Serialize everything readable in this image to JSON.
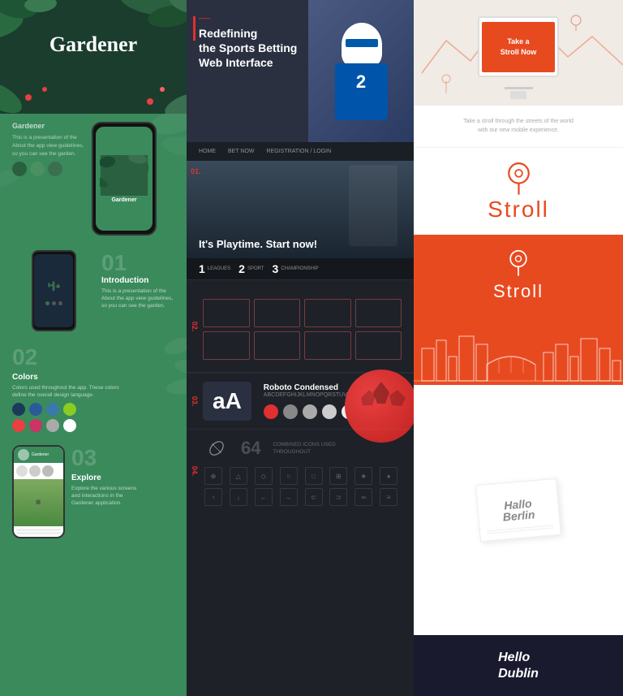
{
  "left": {
    "title": "Gardener",
    "app_name": "Gardener",
    "section_01_label": "01",
    "section_01_heading": "Introduction",
    "section_01_text": "This is a presentation of the About the app view guidelines, so you can see the garden.",
    "section_02_label": "02",
    "section_02_heading": "Colors",
    "section_02_text": "Colors used throughout the app. These colors define the overall design language.",
    "section_03_label": "03",
    "section_03_heading": "Explore",
    "section_03_text": "Explore the various screens and interactions in the Gardener application.",
    "colors": [
      {
        "hex": "#1a3a5a",
        "name": "dark-blue"
      },
      {
        "hex": "#2a5a9a",
        "name": "blue"
      },
      {
        "hex": "#3a7aaa",
        "name": "light-blue"
      },
      {
        "hex": "#8acc22",
        "name": "green"
      },
      {
        "hex": "#e84040",
        "name": "red"
      },
      {
        "hex": "#cccccc",
        "name": "gray"
      },
      {
        "hex": "#ffffff",
        "name": "white"
      }
    ]
  },
  "middle": {
    "title": "Sports",
    "hero_text_line1": "Redefining",
    "hero_text_line2": "the Sports Betting",
    "hero_text_line3": "Web Interface",
    "gameplay_text": "It's Playtime. Start now!",
    "stat_1_num": "1",
    "stat_1_label": "LEAGUES",
    "stat_2_num": "2",
    "stat_2_label": "SPORT",
    "stat_3_num": "3",
    "stat_3_label": "CHAMPIONSHIP",
    "section_01_label": "01.",
    "section_02_label": "02.",
    "section_03_label": "03.",
    "section_04_label": "04.",
    "font_name": "Roboto Condensed",
    "font_sample": "aA",
    "font_description": "ABCDEFGHIJKLMNOPQRSTUVWXYZ",
    "icon_count": "64",
    "nav_items": [
      "HOME",
      "BET NOW",
      "REGISTRATION / LOGIN"
    ]
  },
  "right": {
    "brand_name": "Stroll",
    "brand_name_white": "Stroll",
    "hero_text_line1": "Take a",
    "hero_text_line2": "Stroll Now",
    "small_text_line1": "Take a stroll through the streets of the world",
    "small_text_line2": "with our new mobile experience.",
    "hallo_line1": "Hallo",
    "hallo_line2": "Berlin",
    "hello_dublin_line1": "Hello",
    "hello_dublin_line2": "Dublin",
    "pin_icon": "location-pin",
    "colors": {
      "orange": "#e84a20",
      "dark": "#1a1a2e"
    }
  }
}
